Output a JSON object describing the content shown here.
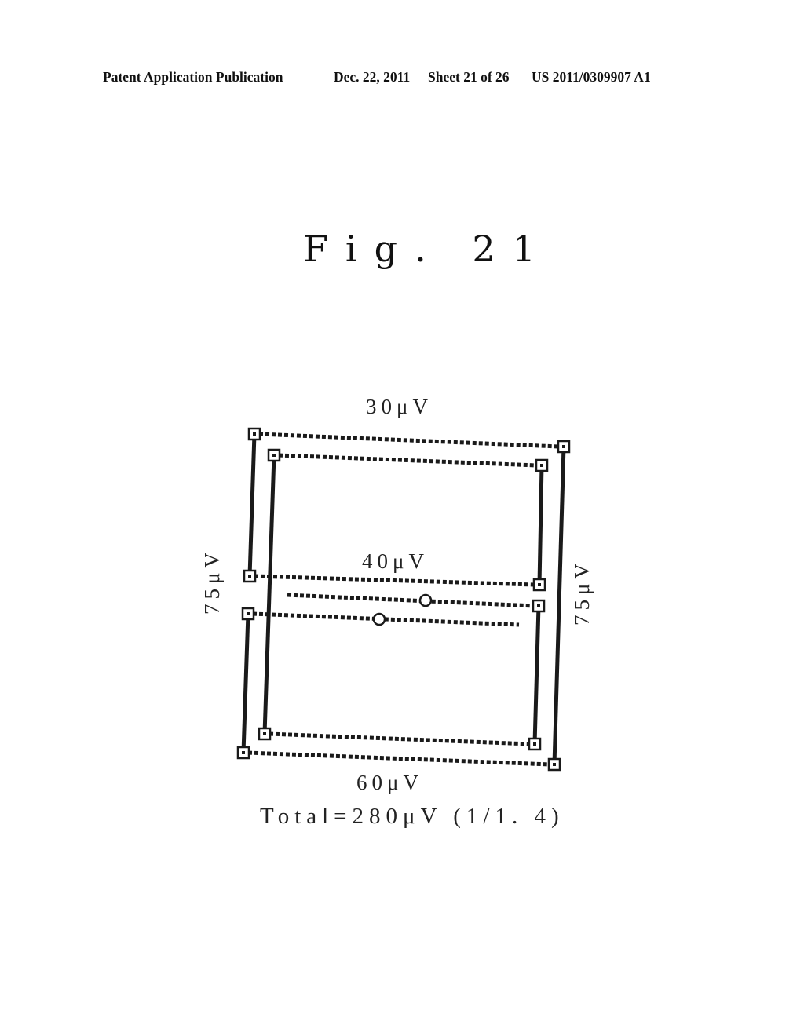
{
  "header": {
    "publication": "Patent Application Publication",
    "date": "Dec. 22, 2011",
    "sheet": "Sheet 21 of 26",
    "number": "US 2011/0309907 A1"
  },
  "figure": {
    "title": "Fig. 21",
    "labels": {
      "top": "30μV",
      "middle": "40μV",
      "left": "75μV",
      "right": "75μV",
      "bottom": "60μV",
      "total": "Total=280μV (1/1. 4)"
    },
    "legend_semantics": {
      "solid_line": "vertical wiring segment",
      "dotted_line": "horizontal wiring segment",
      "square_node": "connection point",
      "circle_node": "measurement point"
    }
  }
}
